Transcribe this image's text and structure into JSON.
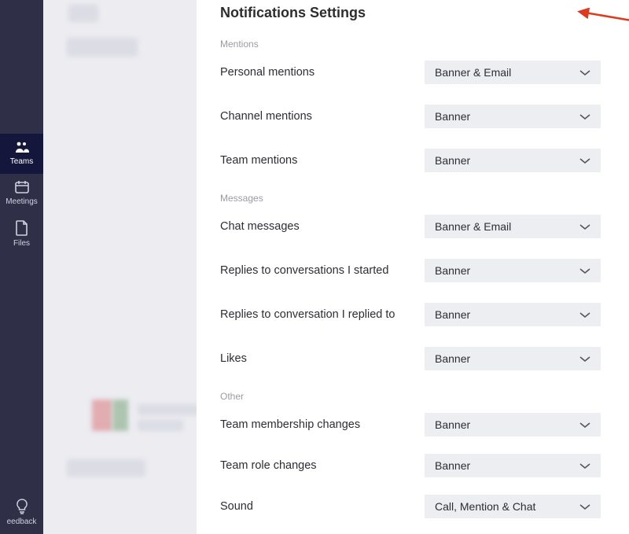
{
  "rail": {
    "items": [
      {
        "id": "teams",
        "label": "Teams",
        "active": true
      },
      {
        "id": "meetings",
        "label": "Meetings",
        "active": false
      },
      {
        "id": "files",
        "label": "Files",
        "active": false
      }
    ],
    "feedback_label": "eedback"
  },
  "panel": {
    "title": "Notifications Settings",
    "sections": [
      {
        "heading": "Mentions",
        "rows": [
          {
            "label": "Personal mentions",
            "value": "Banner & Email"
          },
          {
            "label": "Channel mentions",
            "value": "Banner"
          },
          {
            "label": "Team mentions",
            "value": "Banner"
          }
        ]
      },
      {
        "heading": "Messages",
        "rows": [
          {
            "label": "Chat messages",
            "value": "Banner & Email"
          },
          {
            "label": "Replies to conversations I started",
            "value": "Banner"
          },
          {
            "label": "Replies to conversation I replied to",
            "value": "Banner"
          },
          {
            "label": "Likes",
            "value": "Banner"
          }
        ]
      },
      {
        "heading": "Other",
        "rows": [
          {
            "label": "Team membership changes",
            "value": "Banner"
          },
          {
            "label": "Team role changes",
            "value": "Banner"
          },
          {
            "label": "Sound",
            "value": "Call, Mention & Chat"
          }
        ]
      }
    ]
  }
}
